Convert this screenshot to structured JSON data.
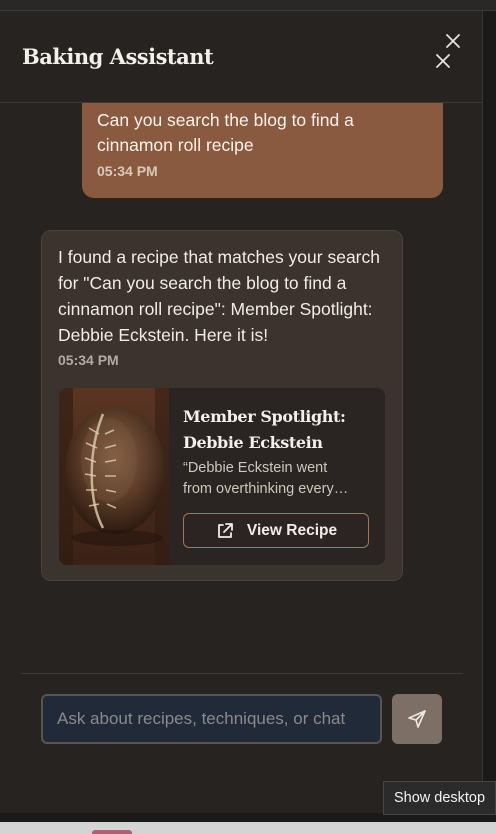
{
  "header": {
    "title": "Baking Assistant"
  },
  "messages": {
    "user": {
      "text": "Can you search the blog to find a cinnamon roll recipe",
      "time": "05:34 PM"
    },
    "assistant": {
      "text": "I found a recipe that matches your search for \"Can you search the blog to find a cinnamon roll recipe\": Member Spotlight: Debbie Eckstein. Here it is!",
      "time": "05:34 PM",
      "recipe_card": {
        "title": "Member Spotlight: Debbie Eckstein",
        "description_line1": "“Debbie Eckstein went",
        "description_line2": "from overthinking every…",
        "button_label": "View Recipe"
      }
    }
  },
  "composer": {
    "placeholder": "Ask about recipes, techniques, or chat"
  },
  "tooltip": {
    "text": "Show desktop"
  },
  "colors": {
    "user_bubble": "#8a5a40",
    "assistant_bubble": "#3a332e",
    "panel": "#262320",
    "input_bg": "#202a38",
    "send_button": "#7d6f66"
  }
}
